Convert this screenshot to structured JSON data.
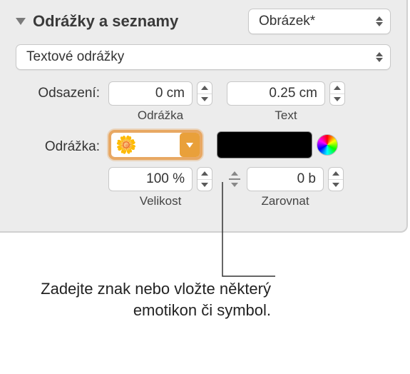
{
  "header": {
    "title": "Odrážky a seznamy",
    "style_preset": "Obrázek*"
  },
  "bullet_type": "Textové odrážky",
  "indent": {
    "label": "Odsazení:",
    "bullet_value": "0 cm",
    "bullet_caption": "Odrážka",
    "text_value": "0.25 cm",
    "text_caption": "Text"
  },
  "bullet_row": {
    "label": "Odrážka:",
    "emoji": "🌼"
  },
  "size": {
    "value": "100 %",
    "caption": "Velikost"
  },
  "align": {
    "value": "0 b",
    "caption": "Zarovnat"
  },
  "callout": "Zadejte znak nebo vložte některý emotikon či symbol."
}
